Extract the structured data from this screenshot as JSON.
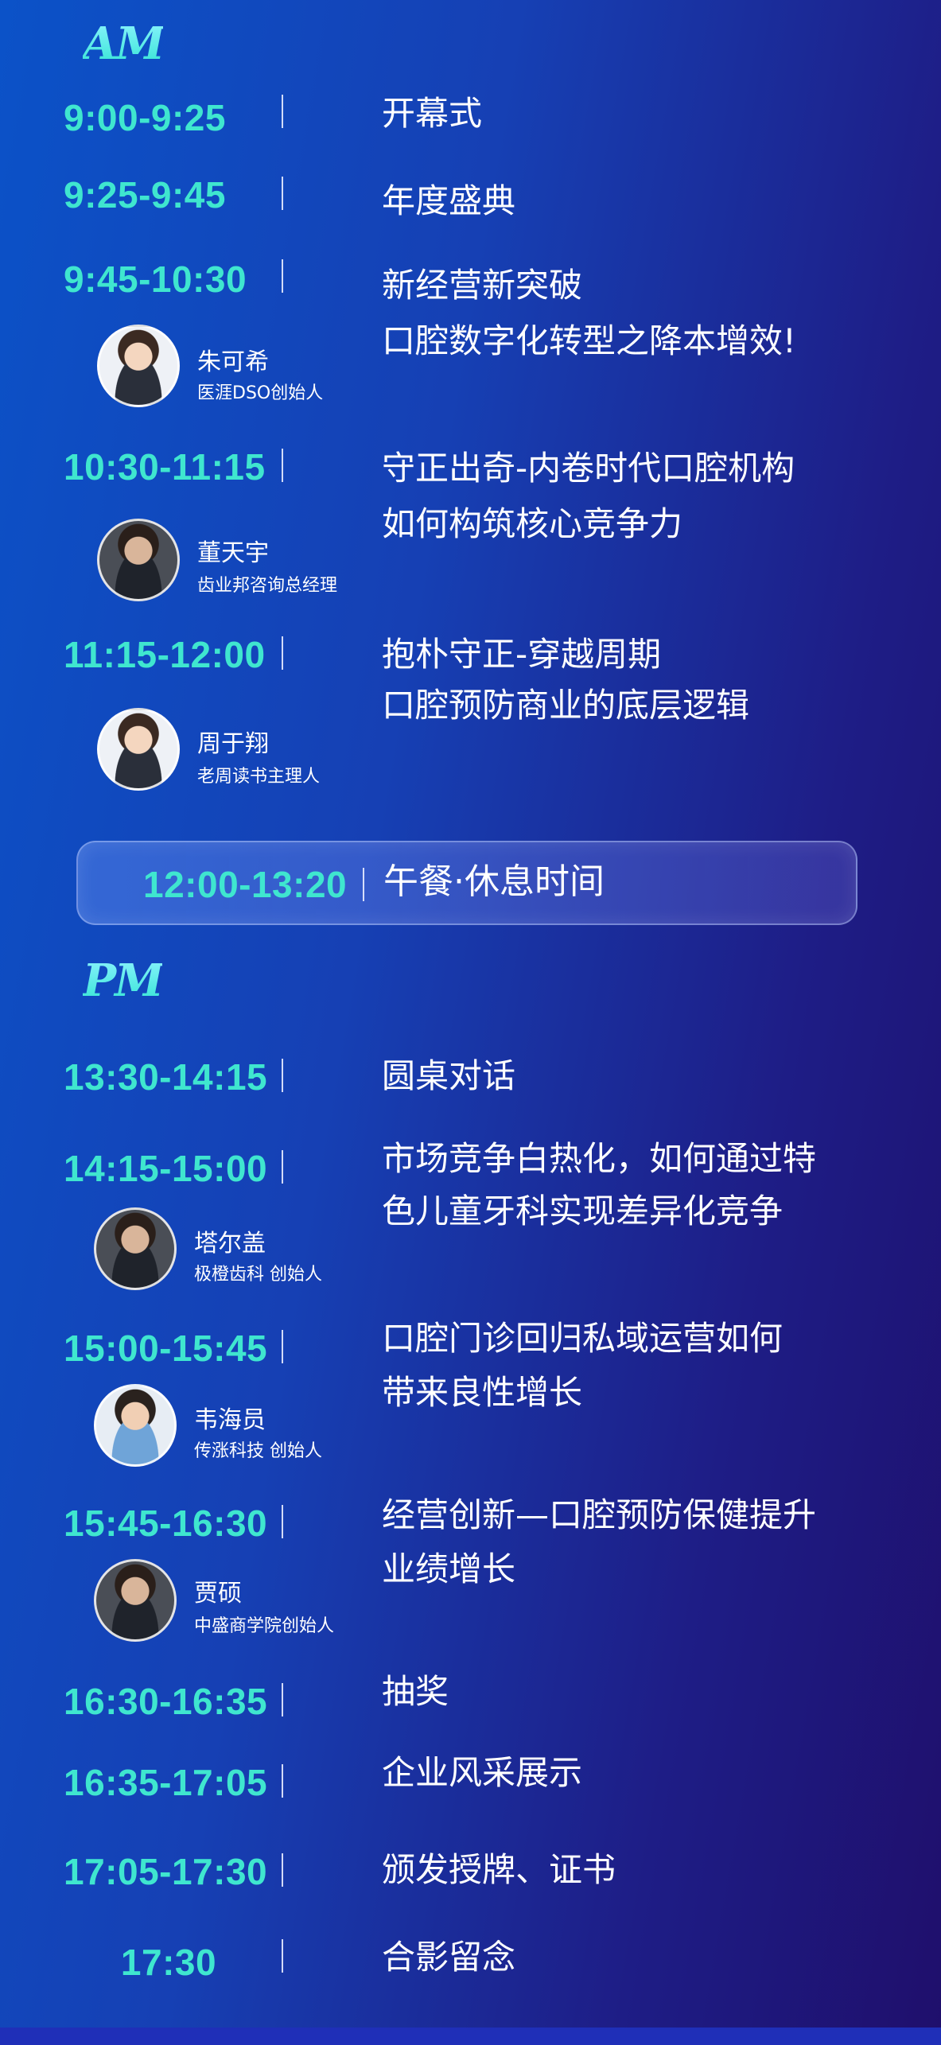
{
  "am_label": "AM",
  "pm_label": "PM",
  "am_items": [
    {
      "time": "9:00-9:25",
      "title": [
        "开幕式"
      ]
    },
    {
      "time": "9:25-9:45",
      "title": [
        "年度盛典"
      ]
    },
    {
      "time": "9:45-10:30",
      "title": [
        "新经营新突破",
        "口腔数字化转型之降本增效!"
      ],
      "speaker": {
        "name": "朱可希",
        "role": "医涯DSO创始人"
      }
    },
    {
      "time": "10:30-11:15",
      "title": [
        "守正出奇-内卷时代口腔机构",
        "如何构筑核心竞争力"
      ],
      "speaker": {
        "name": "董天宇",
        "role": "齿业邦咨询总经理"
      }
    },
    {
      "time": "11:15-12:00",
      "title": [
        "抱朴守正-穿越周期",
        "口腔预防商业的底层逻辑"
      ],
      "speaker": {
        "name": "周于翔",
        "role": "老周读书主理人"
      }
    }
  ],
  "lunch": {
    "time": "12:00-13:20",
    "title": "午餐·休息时间"
  },
  "pm_items": [
    {
      "time": "13:30-14:15",
      "title": [
        "圆桌对话"
      ]
    },
    {
      "time": "14:15-15:00",
      "title": [
        "市场竞争白热化，如何通过特",
        "色儿童牙科实现差异化竞争"
      ],
      "speaker": {
        "name": "塔尔盖",
        "role": "极橙齿科 创始人"
      }
    },
    {
      "time": "15:00-15:45",
      "title": [
        "口腔门诊回归私域运营如何",
        "带来良性增长"
      ],
      "speaker": {
        "name": "韦海员",
        "role": "传涨科技 创始人"
      }
    },
    {
      "time": "15:45-16:30",
      "title": [
        "经营创新—口腔预防保健提升",
        "业绩增长"
      ],
      "speaker": {
        "name": "贾硕",
        "role": "中盛商学院创始人"
      }
    },
    {
      "time": "16:30-16:35",
      "title": [
        "抽奖"
      ]
    },
    {
      "time": "16:35-17:05",
      "title": [
        "企业风采展示"
      ]
    },
    {
      "time": "17:05-17:30",
      "title": [
        "颁发授牌、证书"
      ]
    },
    {
      "time": "17:30",
      "title": [
        "合影留念"
      ]
    }
  ],
  "colors": {
    "time": "#3fe6cf",
    "text": "#ffffff",
    "bg_start": "#0b52c8",
    "bg_end": "#1f0f6c"
  }
}
